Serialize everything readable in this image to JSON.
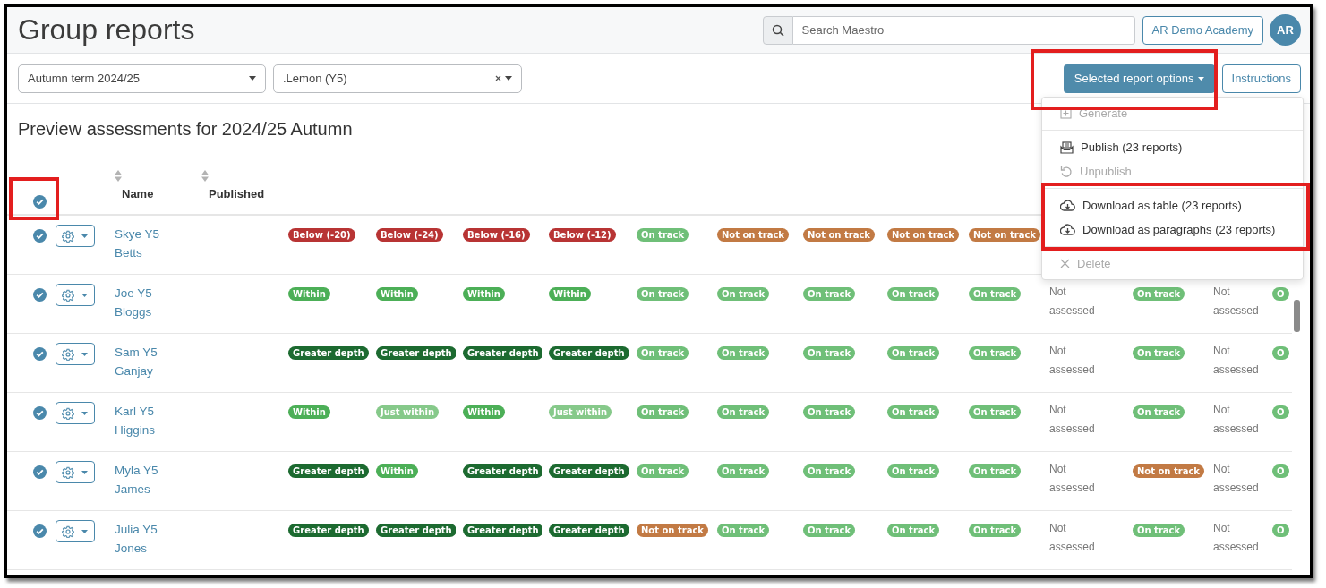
{
  "title": "Group reports",
  "search": {
    "placeholder": "Search Maestro"
  },
  "school_button": "AR Demo Academy",
  "avatar": "AR",
  "filters": [
    {
      "value": "Autumn term 2024/25",
      "clearable": false
    },
    {
      "value": ".Lemon (Y5)",
      "clearable": true
    }
  ],
  "options_button": {
    "label": "Selected report options",
    "expanded": true
  },
  "instructions_button": "Instructions",
  "heading": "Preview assessments for 2024/25 Autumn",
  "menu": {
    "items": [
      {
        "kind": "generate",
        "label": "Generate",
        "disabled": true
      },
      {
        "kind": "divider"
      },
      {
        "kind": "publish",
        "label": "Publish (23 reports)",
        "disabled": false
      },
      {
        "kind": "unpublish",
        "label": "Unpublish",
        "disabled": true
      },
      {
        "kind": "divider"
      },
      {
        "kind": "download",
        "label": "Download as table (23 reports)",
        "disabled": false
      },
      {
        "kind": "download",
        "label": "Download as paragraphs (23 reports)",
        "disabled": false
      },
      {
        "kind": "divider"
      },
      {
        "kind": "delete",
        "label": "Delete",
        "disabled": true
      }
    ]
  },
  "table": {
    "select_all": true,
    "columns": [
      "Name",
      "Published"
    ],
    "rows": [
      {
        "name": "Skye Y5 Betts",
        "selected": true,
        "cells": [
          {
            "kind": "below",
            "text": "Below (-20)"
          },
          {
            "kind": "below",
            "text": "Below (-24)"
          },
          {
            "kind": "below",
            "text": "Below (-16)"
          },
          {
            "kind": "below",
            "text": "Below (-12)"
          },
          {
            "kind": "on-track",
            "text": "On track"
          },
          {
            "kind": "not-on-track",
            "text": "Not on track"
          },
          {
            "kind": "not-on-track",
            "text": "Not on track"
          },
          {
            "kind": "not-on-track",
            "text": "Not on track"
          },
          {
            "kind": "not-on-track",
            "text": "Not on track"
          }
        ]
      },
      {
        "name": "Joe Y5 Bloggs",
        "selected": true,
        "cells": [
          {
            "kind": "within",
            "text": "Within"
          },
          {
            "kind": "within",
            "text": "Within"
          },
          {
            "kind": "within",
            "text": "Within"
          },
          {
            "kind": "within",
            "text": "Within"
          },
          {
            "kind": "on-track",
            "text": "On track"
          },
          {
            "kind": "on-track",
            "text": "On track"
          },
          {
            "kind": "on-track",
            "text": "On track"
          },
          {
            "kind": "on-track",
            "text": "On track"
          },
          {
            "kind": "on-track",
            "text": "On track"
          },
          {
            "kind": "plain",
            "text": "Not assessed"
          },
          {
            "kind": "on-track",
            "text": "On track"
          },
          {
            "kind": "plain",
            "text": "Not assessed"
          },
          {
            "kind": "on-track",
            "text": "O"
          }
        ]
      },
      {
        "name": "Sam Y5 Ganjay",
        "selected": true,
        "cells": [
          {
            "kind": "greater",
            "text": "Greater depth"
          },
          {
            "kind": "greater",
            "text": "Greater depth"
          },
          {
            "kind": "greater",
            "text": "Greater depth"
          },
          {
            "kind": "greater",
            "text": "Greater depth"
          },
          {
            "kind": "on-track",
            "text": "On track"
          },
          {
            "kind": "on-track",
            "text": "On track"
          },
          {
            "kind": "on-track",
            "text": "On track"
          },
          {
            "kind": "on-track",
            "text": "On track"
          },
          {
            "kind": "on-track",
            "text": "On track"
          },
          {
            "kind": "plain",
            "text": "Not assessed"
          },
          {
            "kind": "on-track",
            "text": "On track"
          },
          {
            "kind": "plain",
            "text": "Not assessed"
          },
          {
            "kind": "on-track",
            "text": "O"
          }
        ]
      },
      {
        "name": "Karl Y5 Higgins",
        "selected": true,
        "cells": [
          {
            "kind": "within",
            "text": "Within"
          },
          {
            "kind": "just-within",
            "text": "Just within"
          },
          {
            "kind": "within",
            "text": "Within"
          },
          {
            "kind": "just-within",
            "text": "Just within"
          },
          {
            "kind": "on-track",
            "text": "On track"
          },
          {
            "kind": "on-track",
            "text": "On track"
          },
          {
            "kind": "on-track",
            "text": "On track"
          },
          {
            "kind": "on-track",
            "text": "On track"
          },
          {
            "kind": "on-track",
            "text": "On track"
          },
          {
            "kind": "plain",
            "text": "Not assessed"
          },
          {
            "kind": "on-track",
            "text": "On track"
          },
          {
            "kind": "plain",
            "text": "Not assessed"
          },
          {
            "kind": "on-track",
            "text": "O"
          }
        ]
      },
      {
        "name": "Myla Y5 James",
        "selected": true,
        "cells": [
          {
            "kind": "greater",
            "text": "Greater depth"
          },
          {
            "kind": "within",
            "text": "Within"
          },
          {
            "kind": "greater",
            "text": "Greater depth"
          },
          {
            "kind": "greater",
            "text": "Greater depth"
          },
          {
            "kind": "on-track",
            "text": "On track"
          },
          {
            "kind": "on-track",
            "text": "On track"
          },
          {
            "kind": "on-track",
            "text": "On track"
          },
          {
            "kind": "on-track",
            "text": "On track"
          },
          {
            "kind": "on-track",
            "text": "On track"
          },
          {
            "kind": "plain",
            "text": "Not assessed"
          },
          {
            "kind": "not-on-track",
            "text": "Not on track"
          },
          {
            "kind": "plain",
            "text": "Not assessed"
          },
          {
            "kind": "on-track",
            "text": "O"
          }
        ]
      },
      {
        "name": "Julia Y5 Jones",
        "selected": true,
        "cells": [
          {
            "kind": "greater",
            "text": "Greater depth"
          },
          {
            "kind": "greater",
            "text": "Greater depth"
          },
          {
            "kind": "greater",
            "text": "Greater depth"
          },
          {
            "kind": "greater",
            "text": "Greater depth"
          },
          {
            "kind": "not-on-track",
            "text": "Not on track"
          },
          {
            "kind": "on-track",
            "text": "On track"
          },
          {
            "kind": "on-track",
            "text": "On track"
          },
          {
            "kind": "on-track",
            "text": "On track"
          },
          {
            "kind": "on-track",
            "text": "On track"
          },
          {
            "kind": "plain",
            "text": "Not assessed"
          },
          {
            "kind": "on-track",
            "text": "On track"
          },
          {
            "kind": "plain",
            "text": "Not assessed"
          },
          {
            "kind": "on-track",
            "text": "O"
          }
        ]
      }
    ]
  }
}
